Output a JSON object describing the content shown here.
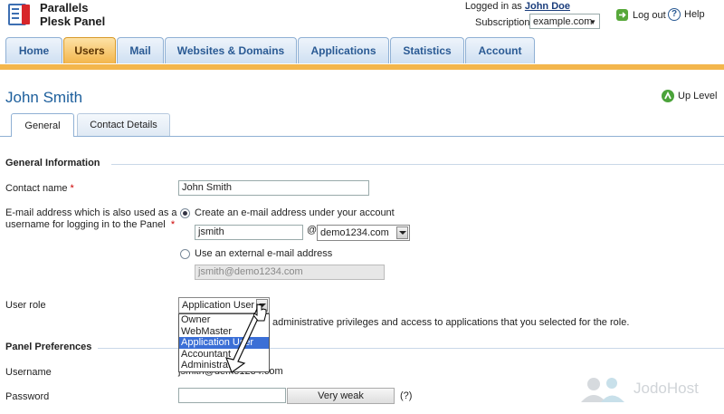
{
  "header": {
    "brand_line1": "Parallels",
    "brand_line2": "Plesk Panel",
    "logged_in_prefix": "Logged in as",
    "logged_in_user": "John Doe",
    "subscription_label": "Subscription",
    "subscription_value": "example.com",
    "logout_label": "Log out",
    "help_label": "Help"
  },
  "nav": {
    "tabs": [
      "Home",
      "Users",
      "Mail",
      "Websites & Domains",
      "Applications",
      "Statistics",
      "Account"
    ],
    "active": "Users"
  },
  "page": {
    "title": "John Smith",
    "up_level": "Up Level"
  },
  "subtabs": {
    "items": [
      "General",
      "Contact Details"
    ],
    "active": "General"
  },
  "general": {
    "section_title": "General Information",
    "contact_name_label": "Contact name",
    "contact_name_value": "John Smith",
    "email_label_line1": "E-mail address which is also used as a",
    "email_label_line2": "username for logging in to the Panel",
    "option_create": "Create an e-mail address under your account",
    "email_local": "jsmith",
    "at_sign": "@",
    "email_domain": "demo1234.com",
    "option_external": "Use an external e-mail address",
    "external_placeholder": "jsmith@demo1234.com",
    "user_role_label": "User role",
    "user_role_value": "Application User",
    "role_options": [
      "Owner",
      "WebMaster",
      "Application User",
      "Accountant",
      "Administrator"
    ],
    "role_selected_index": 2,
    "role_hint": "administrative privileges and access to applications that you selected for the role."
  },
  "prefs": {
    "section_title": "Panel Preferences",
    "username_label": "Username",
    "username_value": "jsmith@demo1234.com",
    "password_label": "Password",
    "password_strength": "Very weak",
    "password_help": "(?)"
  },
  "watermark": "JodoHost",
  "colors": {
    "accent_orange": "#f3b64c",
    "link_blue": "#1d5f9c",
    "selected_option": "#3b6fd6"
  }
}
